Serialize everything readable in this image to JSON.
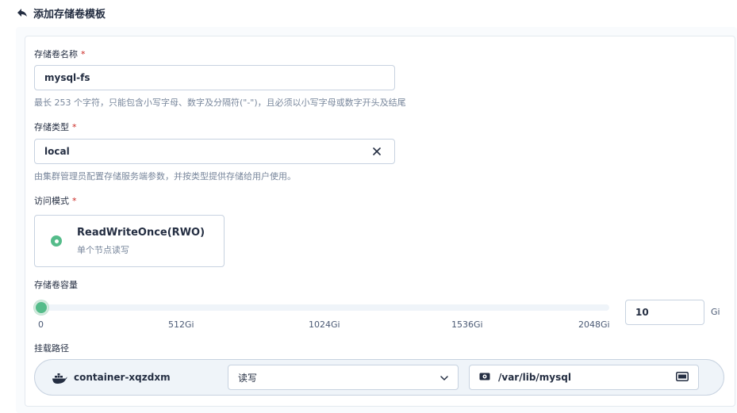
{
  "header": {
    "title": "添加存储卷模板"
  },
  "name_field": {
    "label": "存储卷名称",
    "required_mark": "*",
    "value": "mysql-fs",
    "hint": "最长 253 个字符，只能包含小写字母、数字及分隔符(\"-\")，且必须以小写字母或数字开头及结尾"
  },
  "storage_type": {
    "label": "存储类型",
    "required_mark": "*",
    "value": "local",
    "hint": "由集群管理员配置存储服务端参数，并按类型提供存储给用户使用。"
  },
  "access_mode": {
    "label": "访问模式",
    "required_mark": "*",
    "option_title": "ReadWriteOnce(RWO)",
    "option_desc": "单个节点读写",
    "selected": true
  },
  "capacity": {
    "label": "存储卷容量",
    "value": "10",
    "unit": "Gi",
    "ticks": [
      "0",
      "512Gi",
      "1024Gi",
      "1536Gi",
      "2048Gi"
    ],
    "min": 0,
    "max": 2048
  },
  "mount": {
    "label": "挂载路径",
    "container": "container-xqzdxm",
    "mode": "读写",
    "path": "/var/lib/mysql"
  },
  "colors": {
    "accent": "#55bc8a",
    "required": "#ca2621",
    "text": "#242e42",
    "hint": "#79879c",
    "border": "#c7d2e0"
  },
  "icons": {
    "back": "back-arrow-icon",
    "clear": "close-icon",
    "docker": "docker-icon",
    "dropdown": "chevron-down-icon",
    "disk": "disk-icon",
    "volume": "volume-icon"
  }
}
